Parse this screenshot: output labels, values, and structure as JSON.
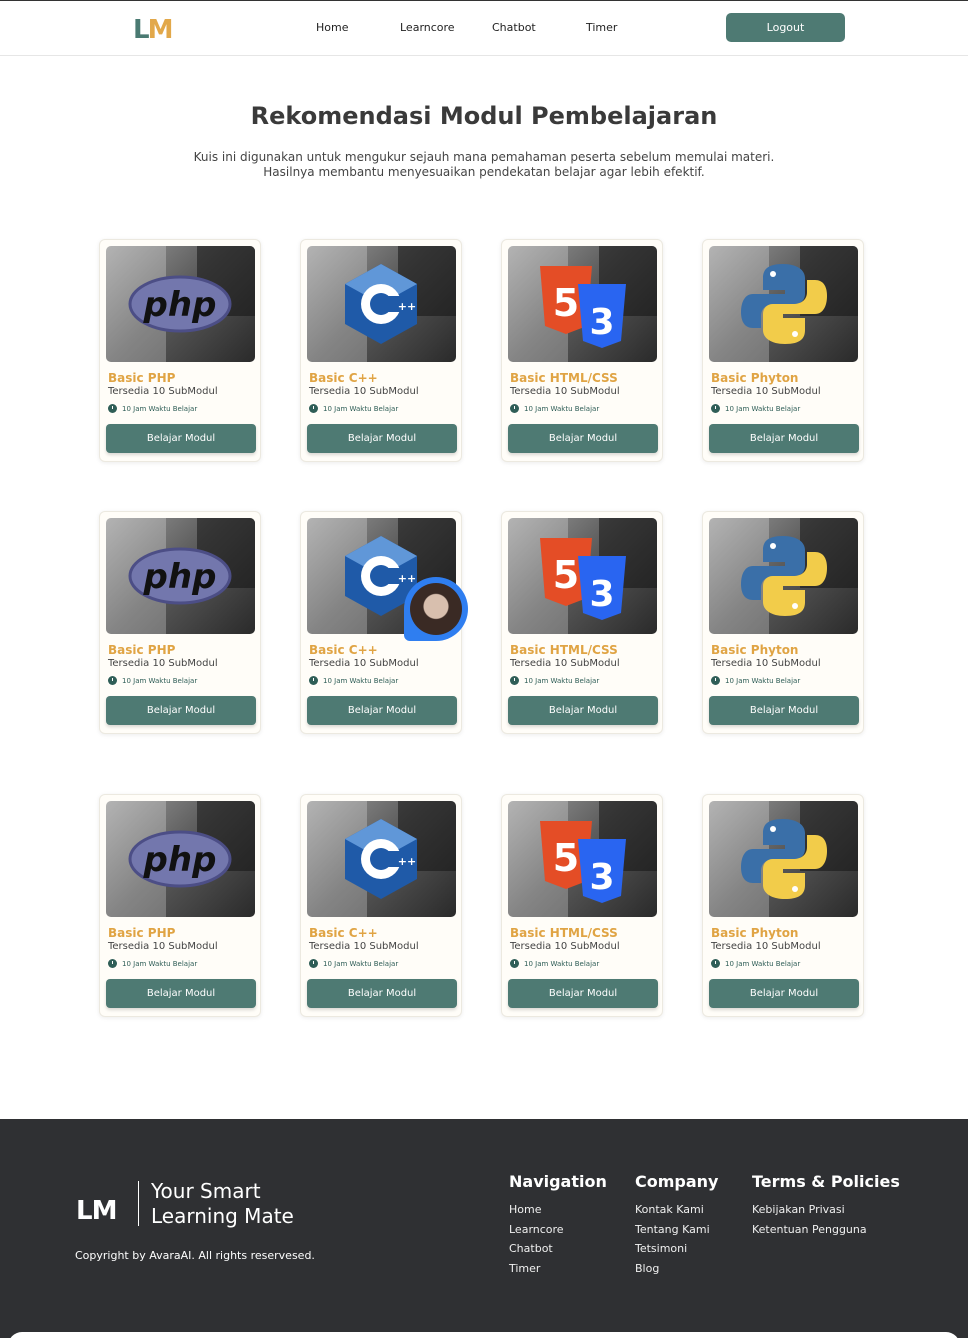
{
  "header": {
    "logo_l": "L",
    "logo_m": "M",
    "nav": [
      "Home",
      "Learncore",
      "Chatbot",
      "Timer"
    ],
    "logout_label": "Logout"
  },
  "hero": {
    "title": "Rekomendasi Modul Pembelajaran",
    "subtitle_line1": "Kuis ini digunakan untuk mengukur sejauh mana pemahaman peserta sebelum memulai materi.",
    "subtitle_line2": "Hasilnya membantu menyesuaikan pendekatan belajar agar lebih efektif."
  },
  "cards": [
    {
      "title": "Basic PHP",
      "sub": "Tersedia 10 SubModul",
      "time": "10 Jam Waktu Belajar",
      "button": "Belajar Modul",
      "icon": "php-logo-icon"
    },
    {
      "title": "Basic C++",
      "sub": "Tersedia 10 SubModul",
      "time": "10 Jam Waktu Belajar",
      "button": "Belajar Modul",
      "icon": "cpp-logo-icon"
    },
    {
      "title": "Basic HTML/CSS",
      "sub": "Tersedia 10 SubModul",
      "time": "10 Jam Waktu Belajar",
      "button": "Belajar Modul",
      "icon": "html-css-logo-icon"
    },
    {
      "title": "Basic Phyton",
      "sub": "Tersedia 10 SubModul",
      "time": "10 Jam Waktu Belajar",
      "button": "Belajar Modul",
      "icon": "python-logo-icon"
    },
    {
      "title": "Basic PHP",
      "sub": "Tersedia 10 SubModul",
      "time": "10 Jam Waktu Belajar",
      "button": "Belajar Modul",
      "icon": "php-logo-icon"
    },
    {
      "title": "Basic C++",
      "sub": "Tersedia 10 SubModul",
      "time": "10 Jam Waktu Belajar",
      "button": "Belajar Modul",
      "icon": "cpp-logo-icon"
    },
    {
      "title": "Basic HTML/CSS",
      "sub": "Tersedia 10 SubModul",
      "time": "10 Jam Waktu Belajar",
      "button": "Belajar Modul",
      "icon": "html-css-logo-icon"
    },
    {
      "title": "Basic Phyton",
      "sub": "Tersedia 10 SubModul",
      "time": "10 Jam Waktu Belajar",
      "button": "Belajar Modul",
      "icon": "python-logo-icon"
    },
    {
      "title": "Basic PHP",
      "sub": "Tersedia 10 SubModul",
      "time": "10 Jam Waktu Belajar",
      "button": "Belajar Modul",
      "icon": "php-logo-icon"
    },
    {
      "title": "Basic C++",
      "sub": "Tersedia 10 SubModul",
      "time": "10 Jam Waktu Belajar",
      "button": "Belajar Modul",
      "icon": "cpp-logo-icon"
    },
    {
      "title": "Basic HTML/CSS",
      "sub": "Tersedia 10 SubModul",
      "time": "10 Jam Waktu Belajar",
      "button": "Belajar Modul",
      "icon": "html-css-logo-icon"
    },
    {
      "title": "Basic Phyton",
      "sub": "Tersedia 10 SubModul",
      "time": "10 Jam Waktu Belajar",
      "button": "Belajar Modul",
      "icon": "python-logo-icon"
    }
  ],
  "footer": {
    "logo": "LM",
    "tagline_line1": "Your Smart",
    "tagline_line2": "Learning Mate",
    "copyright": "Copyright by AvaraAI. All rights reservesed.",
    "columns": [
      {
        "title": "Navigation",
        "links": [
          "Home",
          "Learncore",
          "Chatbot",
          "Timer"
        ]
      },
      {
        "title": "Company",
        "links": [
          "Kontak Kami",
          "Tentang Kami",
          "Tetsimoni",
          "Blog"
        ]
      },
      {
        "title": "Terms & Policies",
        "links": [
          "Kebijakan Privasi",
          "Ketentuan Pengguna"
        ]
      }
    ]
  },
  "colors": {
    "primary": "#4e7a73",
    "accent": "#e0a444",
    "footer_bg": "#2f3033"
  }
}
